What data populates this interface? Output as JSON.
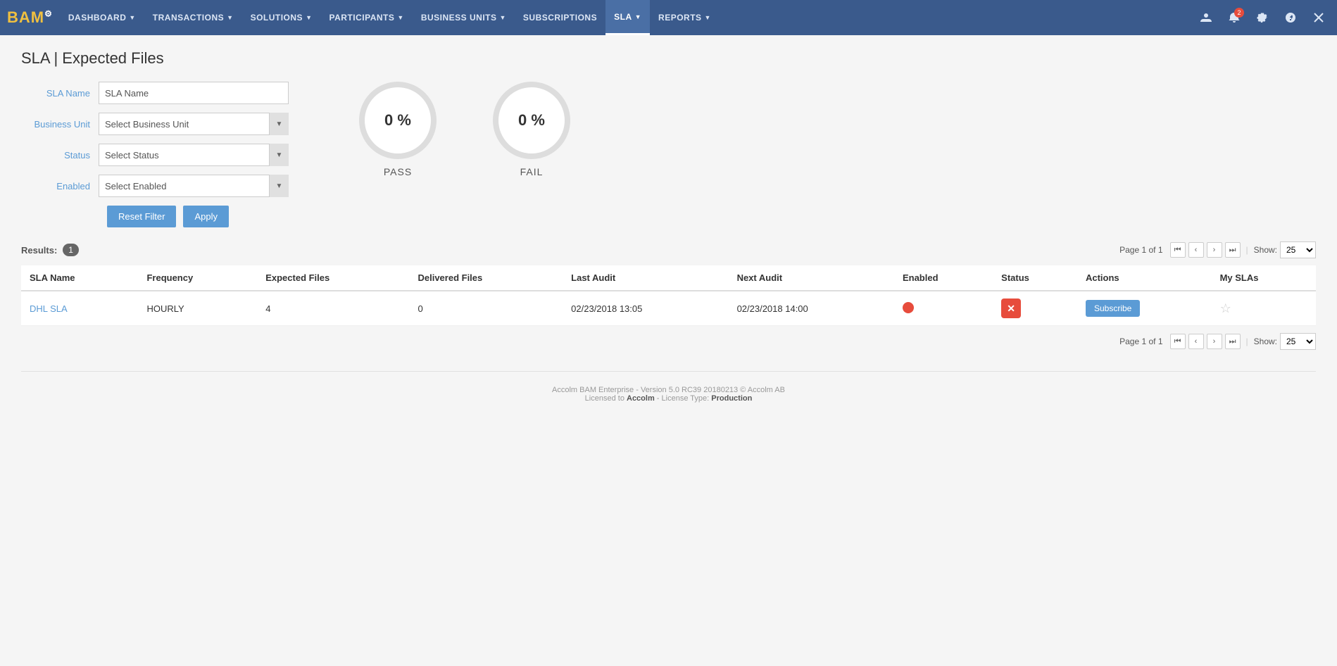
{
  "brand": {
    "name": "BAM",
    "icon": "⚙"
  },
  "nav": {
    "items": [
      {
        "label": "DASHBOARD",
        "has_arrow": true,
        "active": false
      },
      {
        "label": "TRANSACTIONS",
        "has_arrow": true,
        "active": false
      },
      {
        "label": "SOLUTIONS",
        "has_arrow": true,
        "active": false
      },
      {
        "label": "PARTICIPANTS",
        "has_arrow": true,
        "active": false
      },
      {
        "label": "BUSINESS UNITS",
        "has_arrow": true,
        "active": false
      },
      {
        "label": "SUBSCRIPTIONS",
        "has_arrow": false,
        "active": false
      },
      {
        "label": "SLA",
        "has_arrow": true,
        "active": true
      },
      {
        "label": "REPORTS",
        "has_arrow": true,
        "active": false
      }
    ],
    "notification_count": "2"
  },
  "page": {
    "title": "SLA | Expected Files"
  },
  "filters": {
    "sla_name_label": "SLA Name",
    "sla_name_placeholder": "SLA Name",
    "business_unit_label": "Business Unit",
    "business_unit_placeholder": "Select Business Unit",
    "status_label": "Status",
    "status_placeholder": "Select Status",
    "enabled_label": "Enabled",
    "enabled_placeholder": "Select Enabled",
    "reset_button": "Reset Filter",
    "apply_button": "Apply"
  },
  "gauges": [
    {
      "value": "0 %",
      "label": "PASS"
    },
    {
      "value": "0 %",
      "label": "FAIL"
    }
  ],
  "results": {
    "label": "Results:",
    "count": "1",
    "page_info_top": "Page 1 of 1",
    "page_info_bottom": "Page 1 of 1",
    "show_label": "Show:",
    "show_value": "25"
  },
  "table": {
    "headers": [
      "SLA Name",
      "Frequency",
      "Expected Files",
      "Delivered Files",
      "Last Audit",
      "Next Audit",
      "Enabled",
      "Status",
      "Actions",
      "My SLAs"
    ],
    "rows": [
      {
        "sla_name": "DHL SLA",
        "frequency": "HOURLY",
        "expected_files": "4",
        "delivered_files": "0",
        "last_audit": "02/23/2018 13:05",
        "next_audit": "02/23/2018 14:00",
        "enabled": "red_dot",
        "status": "x",
        "action": "Subscribe",
        "my_slas": "star"
      }
    ]
  },
  "footer": {
    "line1": "Accolm BAM Enterprise - Version 5.0 RC39 20180213 © Accolm AB",
    "line2_prefix": "Licensed to ",
    "line2_company": "Accolm",
    "line2_suffix": " - License Type: ",
    "line2_type": "Production"
  }
}
